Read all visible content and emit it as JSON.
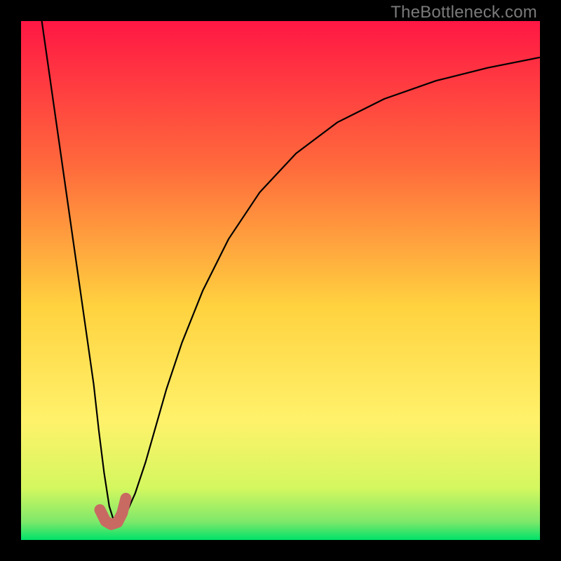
{
  "watermark": "TheBottleneck.com",
  "chart_data": {
    "type": "line",
    "title": "",
    "xlabel": "",
    "ylabel": "",
    "xlim": [
      0,
      100
    ],
    "ylim": [
      0,
      100
    ],
    "grid": false,
    "legend": false,
    "gradient_stops": [
      {
        "offset": 0.0,
        "color": "#ff1744"
      },
      {
        "offset": 0.28,
        "color": "#ff6a3c"
      },
      {
        "offset": 0.55,
        "color": "#ffd23f"
      },
      {
        "offset": 0.77,
        "color": "#fff26b"
      },
      {
        "offset": 0.9,
        "color": "#d4f75f"
      },
      {
        "offset": 0.965,
        "color": "#7ee86a"
      },
      {
        "offset": 1.0,
        "color": "#00e26a"
      }
    ],
    "series": [
      {
        "name": "bottleneck-curve",
        "color": "#000000",
        "width": 2.2,
        "x": [
          4,
          6,
          8,
          10,
          12,
          14,
          15,
          16,
          17,
          18,
          19,
          20,
          22,
          24,
          26,
          28,
          31,
          35,
          40,
          46,
          53,
          61,
          70,
          80,
          90,
          100
        ],
        "y": [
          100,
          86,
          72,
          58,
          44,
          30,
          21,
          13,
          6.5,
          3.3,
          3.1,
          4.5,
          9,
          15,
          22,
          29,
          38,
          48,
          58,
          67,
          74.5,
          80.5,
          85,
          88.5,
          91,
          93
        ]
      },
      {
        "name": "minimum-marker",
        "type": "marker-path",
        "color": "#c86a62",
        "width": 16,
        "linecap": "round",
        "x": [
          15.2,
          16.3,
          17.4,
          18.6,
          19.5,
          20.2
        ],
        "y": [
          5.8,
          3.6,
          3.0,
          3.4,
          5.2,
          8.0
        ]
      }
    ]
  }
}
